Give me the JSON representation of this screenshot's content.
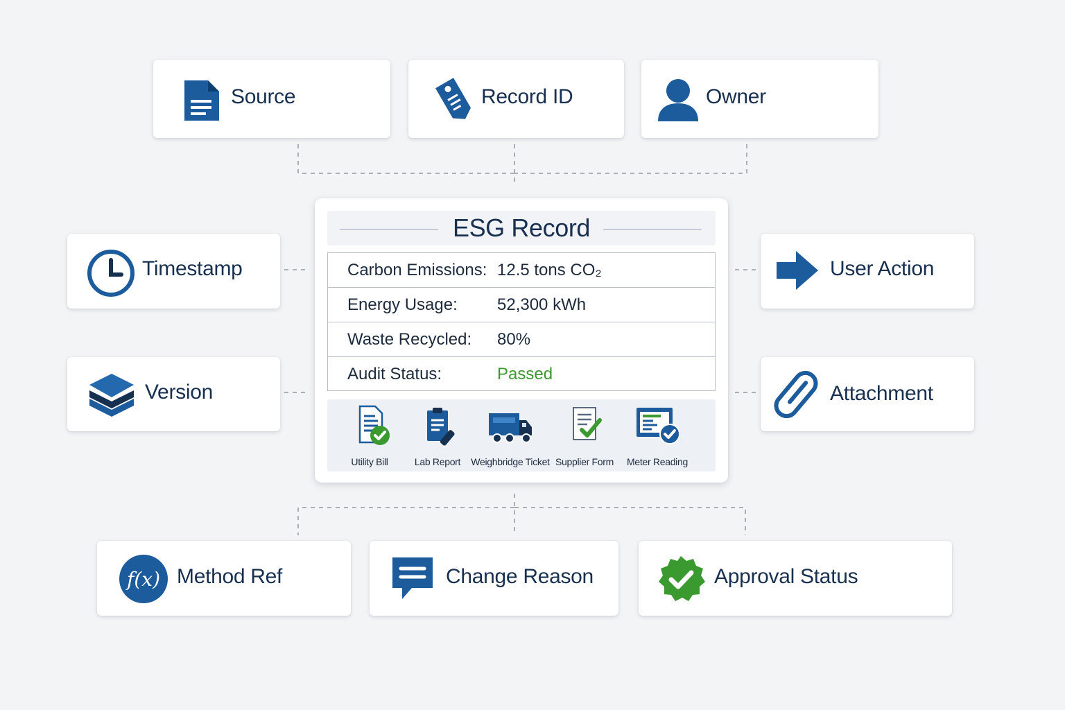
{
  "top_nodes": [
    {
      "label": "Source",
      "icon": "document-icon"
    },
    {
      "label": "Record ID",
      "icon": "tag-icon"
    },
    {
      "label": "Owner",
      "icon": "user-icon"
    }
  ],
  "left_nodes": [
    {
      "label": "Timestamp",
      "icon": "clock-icon"
    },
    {
      "label": "Version",
      "icon": "layers-icon"
    }
  ],
  "right_nodes": [
    {
      "label": "User Action",
      "icon": "arrow-right-icon"
    },
    {
      "label": "Attachment",
      "icon": "paperclip-icon"
    }
  ],
  "bottom_nodes": [
    {
      "label": "Method Ref",
      "icon": "function-icon",
      "icon_text": "f(x)"
    },
    {
      "label": "Change Reason",
      "icon": "chat-icon"
    },
    {
      "label": "Approval Status",
      "icon": "check-badge-icon"
    }
  ],
  "record": {
    "title": "ESG Record",
    "metrics": [
      {
        "label": "Carbon Emissions:",
        "value": "12.5 tons CO₂"
      },
      {
        "label": "Energy Usage:",
        "value": "52,300 kWh"
      },
      {
        "label": "Waste Recycled:",
        "value": "80%"
      },
      {
        "label": "Audit Status:",
        "value": "Passed",
        "status": "ok"
      }
    ],
    "evidence": [
      {
        "label": "Utility Bill",
        "icon": "bill-check-icon"
      },
      {
        "label": "Lab Report",
        "icon": "clipboard-icon"
      },
      {
        "label": "Weighbridge Ticket",
        "icon": "truck-icon"
      },
      {
        "label": "Supplier Form",
        "icon": "form-check-icon"
      },
      {
        "label": "Meter Reading",
        "icon": "meter-check-icon"
      }
    ]
  },
  "colors": {
    "brand": "#1c5b9c",
    "navy": "#17304f",
    "success": "#3a9a2f",
    "connector": "#a9afb7"
  }
}
